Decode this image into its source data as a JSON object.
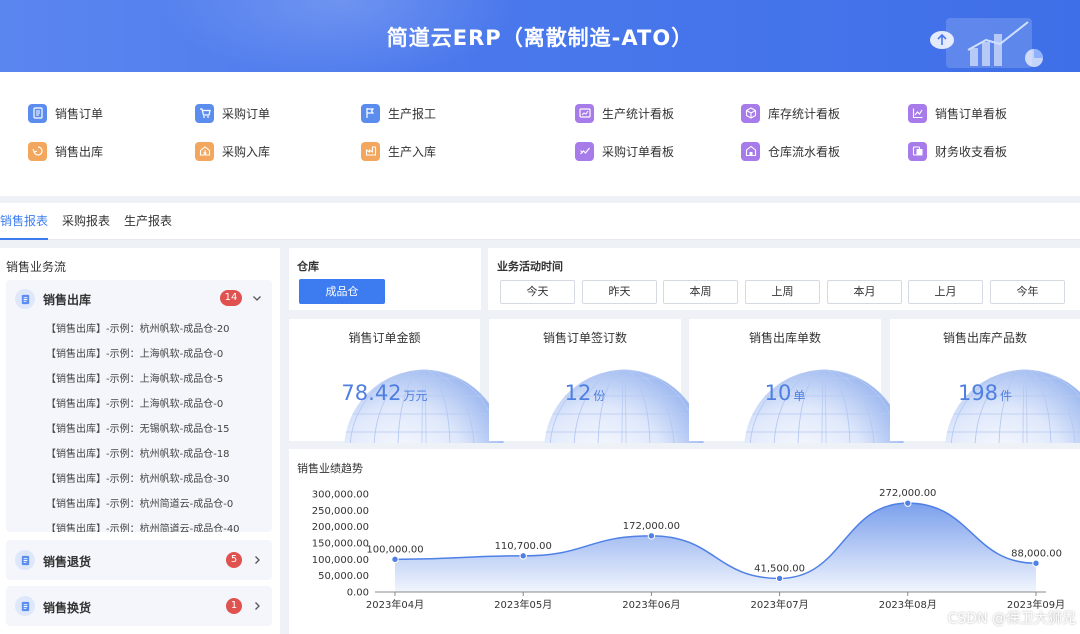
{
  "app": {
    "title": "简道云ERP（离散制造-ATO）"
  },
  "quick_links": [
    {
      "label": "销售订单",
      "icon": "document-icon",
      "color": "#5b8def"
    },
    {
      "label": "采购订单",
      "icon": "cart-icon",
      "color": "#5b8def"
    },
    {
      "label": "生产报工",
      "icon": "report-icon",
      "color": "#5b8def"
    },
    {
      "label": "生产统计看板",
      "icon": "dashboard-icon",
      "color": "#a77bea"
    },
    {
      "label": "库存统计看板",
      "icon": "box-icon",
      "color": "#a77bea"
    },
    {
      "label": "销售订单看板",
      "icon": "line-chart-icon",
      "color": "#a77bea"
    },
    {
      "label": "销售出库",
      "icon": "outbound-icon",
      "color": "#f2a65e"
    },
    {
      "label": "采购入库",
      "icon": "inbound-icon",
      "color": "#f2a65e"
    },
    {
      "label": "生产入库",
      "icon": "factory-inbound-icon",
      "color": "#f2a65e"
    },
    {
      "label": "采购订单看板",
      "icon": "trend-icon",
      "color": "#a77bea"
    },
    {
      "label": "仓库流水看板",
      "icon": "warehouse-icon",
      "color": "#a77bea"
    },
    {
      "label": "财务收支看板",
      "icon": "finance-icon",
      "color": "#a77bea"
    }
  ],
  "tabs": [
    "销售报表",
    "采购报表",
    "生产报表"
  ],
  "active_tab": "销售报表",
  "sales_flow": {
    "title": "销售业务流",
    "groups": [
      {
        "label": "销售出库",
        "count": "14",
        "expanded": true,
        "items": [
          "【销售出库】-示例：杭州帆软-成品仓-20",
          "【销售出库】-示例：上海帆软-成品仓-0",
          "【销售出库】-示例：上海帆软-成品仓-5",
          "【销售出库】-示例：上海帆软-成品仓-0",
          "【销售出库】-示例：无锡帆软-成品仓-15",
          "【销售出库】-示例：杭州帆软-成品仓-18",
          "【销售出库】-示例：杭州帆软-成品仓-30",
          "【销售出库】-示例：杭州简道云-成品仓-0",
          "【销售出库】-示例：杭州简道云-成品仓-40"
        ]
      },
      {
        "label": "销售退货",
        "count": "5",
        "expanded": false
      },
      {
        "label": "销售换货",
        "count": "1",
        "expanded": false
      }
    ]
  },
  "filters": {
    "warehouse": {
      "label": "仓库",
      "selected": "成品仓"
    },
    "time": {
      "label": "业务活动时间",
      "options": [
        "今天",
        "昨天",
        "本周",
        "上周",
        "本月",
        "上月",
        "今年"
      ]
    }
  },
  "kpis": [
    {
      "title": "销售订单金额",
      "value": "78.42",
      "unit": "万元"
    },
    {
      "title": "销售订单签订数",
      "value": "12",
      "unit": "份"
    },
    {
      "title": "销售出库单数",
      "value": "10",
      "unit": "单"
    },
    {
      "title": "销售出库产品数",
      "value": "198",
      "unit": "件"
    }
  ],
  "trend_title": "销售业绩趋势",
  "chart_data": {
    "type": "area",
    "title": "销售业绩趋势",
    "categories": [
      "2023年04月",
      "2023年05月",
      "2023年06月",
      "2023年07月",
      "2023年08月",
      "2023年09月"
    ],
    "values": [
      100000,
      110700,
      172000,
      41500,
      272000,
      88000
    ],
    "value_labels": [
      "100,000.00",
      "110,700.00",
      "172,000.00",
      "41,500.00",
      "272,000.00",
      "88,000.00"
    ],
    "y_ticks": [
      "0.00",
      "50,000.00",
      "100,000.00",
      "150,000.00",
      "200,000.00",
      "250,000.00",
      "300,000.00"
    ],
    "ylim": [
      0,
      300000
    ],
    "smooth": true,
    "color": "#4f80e6",
    "grid": false
  },
  "watermark": "CSDN @保卫大狮兄"
}
